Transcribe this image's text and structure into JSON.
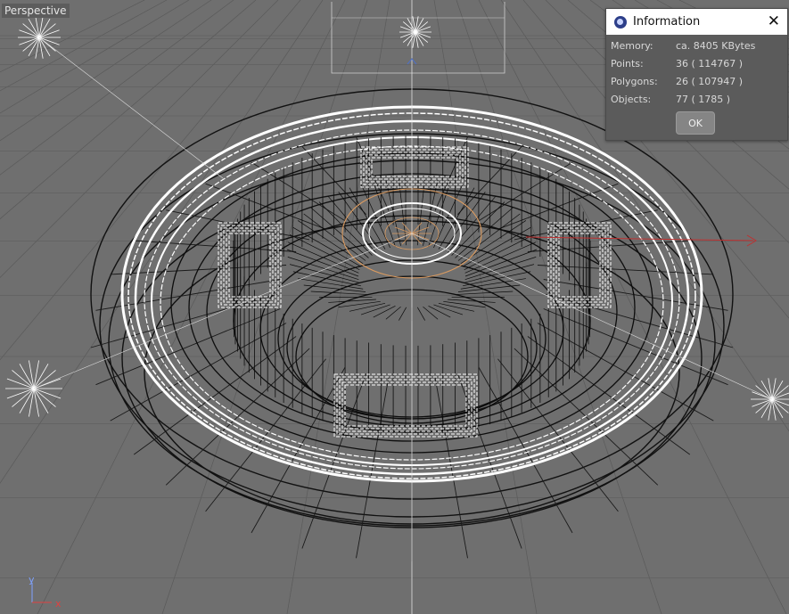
{
  "viewport": {
    "label": "Perspective",
    "axis_x_label": "x",
    "axis_y_label": "y"
  },
  "info_dialog": {
    "title": "Information",
    "rows": [
      {
        "label": "Memory:",
        "value": "ca. 8405 KBytes"
      },
      {
        "label": "Points:",
        "value": "36 ( 114767 )"
      },
      {
        "label": "Polygons:",
        "value": "26 ( 107947 )"
      },
      {
        "label": "Objects:",
        "value": "77 ( 1785 )"
      }
    ],
    "ok_label": "OK",
    "close_icon": "close-icon",
    "app_icon": "cinema4d-icon"
  },
  "colors": {
    "viewport_bg": "#6f6f6f",
    "wire_dark": "#111111",
    "wire_light": "#ffffff",
    "selected_orange": "#d99a60",
    "axis_red": "#c03030"
  }
}
